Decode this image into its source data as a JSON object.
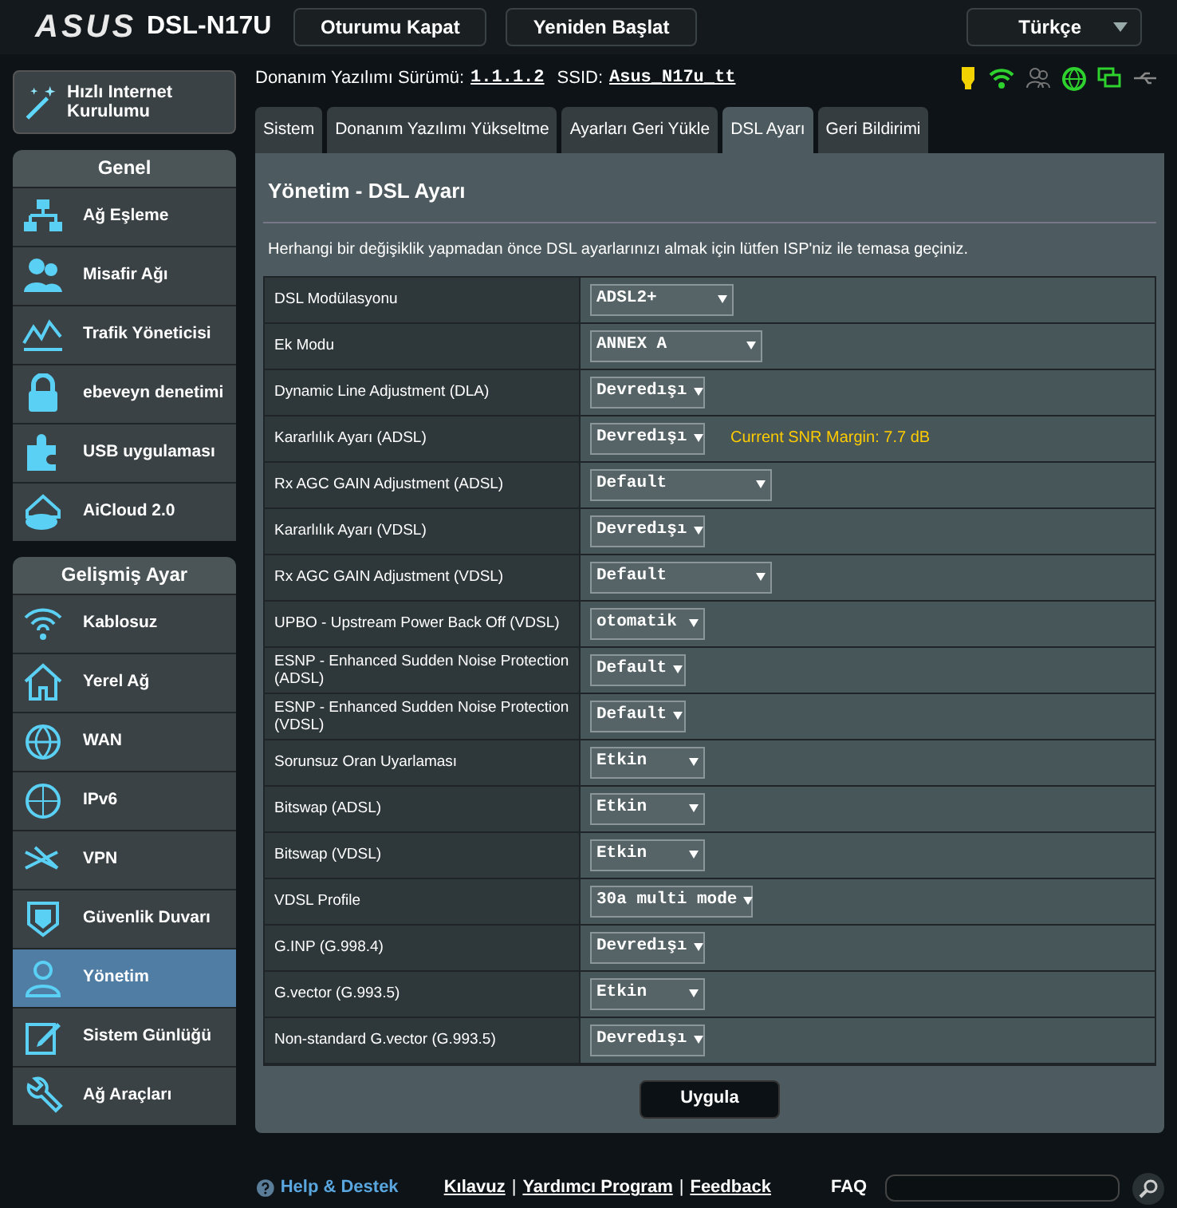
{
  "header": {
    "logo": "ASUS",
    "model": "DSL-N17U",
    "buttons": [
      "Oturumu Kapat",
      "Yeniden Başlat"
    ],
    "language": "Türkçe"
  },
  "quick_setup": "Hızlı Internet Kurulumu",
  "info": {
    "firmware_label": "Donanım Yazılımı Sürümü:",
    "firmware": "1.1.1.2",
    "ssid_label": "SSID:",
    "ssid": "Asus_N17u_tt"
  },
  "sidebar": [
    {
      "title": "Genel",
      "items": [
        {
          "label": "Ağ Eşleme",
          "selected": false
        },
        {
          "label": "Misafir Ağı",
          "selected": false
        },
        {
          "label": "Trafik Yöneticisi",
          "selected": false
        },
        {
          "label": "ebeveyn denetimi",
          "selected": false
        },
        {
          "label": "USB uygulaması",
          "selected": false
        },
        {
          "label": "AiCloud 2.0",
          "selected": false
        }
      ]
    },
    {
      "title": "Gelişmiş Ayar",
      "items": [
        {
          "label": "Kablosuz",
          "selected": false
        },
        {
          "label": "Yerel Ağ",
          "selected": false
        },
        {
          "label": "WAN",
          "selected": false
        },
        {
          "label": "IPv6",
          "selected": false
        },
        {
          "label": "VPN",
          "selected": false
        },
        {
          "label": "Güvenlik Duvarı",
          "selected": false
        },
        {
          "label": "Yönetim",
          "selected": true
        },
        {
          "label": "Sistem Günlüğü",
          "selected": false
        },
        {
          "label": "Ağ Araçları",
          "selected": false
        }
      ]
    }
  ],
  "tabs": [
    {
      "label": "Sistem",
      "selected": false
    },
    {
      "label": "Donanım Yazılımı Yükseltme",
      "selected": false
    },
    {
      "label": "Ayarları Geri Yükle",
      "selected": false
    },
    {
      "label": "DSL Ayarı",
      "selected": true
    },
    {
      "label": "Geri Bildirimi",
      "selected": false
    }
  ],
  "panel": {
    "title": "Yönetim - DSL Ayarı",
    "description": "Herhangi bir değişiklik yapmadan önce DSL ayarlarınızı almak için lütfen ISP'niz ile temasa geçiniz.",
    "rows": [
      {
        "label": "DSL Modülasyonu",
        "value": "ADSL2+"
      },
      {
        "label": "Ek Modu",
        "value": "ANNEX A"
      },
      {
        "label": "Dynamic Line Adjustment (DLA)",
        "value": "Devredışı"
      },
      {
        "label": "Kararlılık Ayarı (ADSL)",
        "value": "Devredışı",
        "note": "Current SNR Margin: 7.7 dB"
      },
      {
        "label": "Rx AGC GAIN Adjustment (ADSL)",
        "value": "Default"
      },
      {
        "label": "Kararlılık Ayarı (VDSL)",
        "value": "Devredışı"
      },
      {
        "label": "Rx AGC GAIN Adjustment (VDSL)",
        "value": "Default"
      },
      {
        "label": "UPBO - Upstream Power Back Off (VDSL)",
        "value": "otomatik"
      },
      {
        "label": "ESNP - Enhanced Sudden Noise Protection (ADSL)",
        "value": "Default"
      },
      {
        "label": "ESNP - Enhanced Sudden Noise Protection (VDSL)",
        "value": "Default"
      },
      {
        "label": "Sorunsuz Oran Uyarlaması",
        "value": "Etkin"
      },
      {
        "label": "Bitswap (ADSL)",
        "value": "Etkin"
      },
      {
        "label": "Bitswap (VDSL)",
        "value": "Etkin"
      },
      {
        "label": "VDSL Profile",
        "value": "30a multi mode"
      },
      {
        "label": "G.INP (G.998.4)",
        "value": "Devredışı"
      },
      {
        "label": "G.vector (G.993.5)",
        "value": "Etkin"
      },
      {
        "label": "Non-standard G.vector (G.993.5)",
        "value": "Devredışı"
      }
    ],
    "apply": "Uygula"
  },
  "footer": {
    "help": "Help & Destek",
    "links": [
      "Kılavuz",
      "Yardımcı Program",
      "Feedback"
    ],
    "separator": "|",
    "faq": "FAQ"
  }
}
